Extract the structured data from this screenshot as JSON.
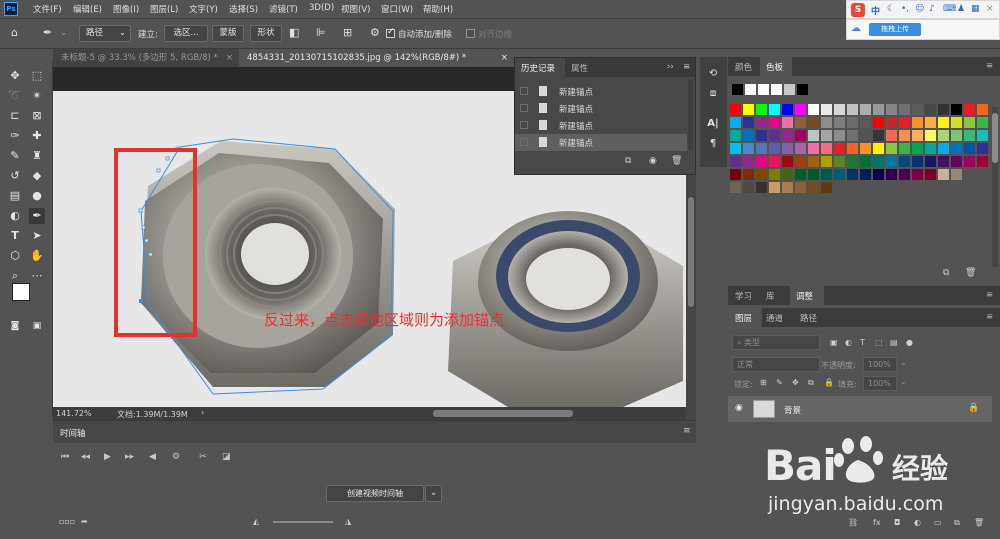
{
  "app": {
    "logo_text": "Ps"
  },
  "menu": [
    "文件(F)",
    "编辑(E)",
    "图像(I)",
    "图层(L)",
    "文字(Y)",
    "选择(S)",
    "滤镜(T)",
    "3D(D)",
    "视图(V)",
    "窗口(W)",
    "帮助(H)"
  ],
  "ime": {
    "logo": "S",
    "lang": "中"
  },
  "cloud": {
    "button": "拖拽上传"
  },
  "options": {
    "mode": "路径",
    "build_label": "建立:",
    "selection_btn": "选区...",
    "mask_btn": "蒙版",
    "shape_btn": "形状",
    "auto_add_delete": "自动添加/删除",
    "align_edges": "对齐边缘"
  },
  "tabs": [
    {
      "label": "未标题-5 @ 33.3% (多边形 5, RGB/8) *",
      "active": false
    },
    {
      "label": "4854331_20130715102835.jpg @ 142%(RGB/8#) *",
      "active": true
    }
  ],
  "canvas": {
    "annotation": "反过来，点击其他区域则为添加锚点"
  },
  "status": {
    "zoom": "141.72%",
    "doc": "文档:1.39M/1.39M"
  },
  "history": {
    "tab_history": "历史记录",
    "tab_properties": "属性",
    "rows": [
      "新建锚点",
      "新建锚点",
      "新建锚点",
      "新建锚点"
    ]
  },
  "timeline": {
    "title": "时间轴",
    "create_btn": "创建视频时间轴"
  },
  "right": {
    "color_tab": "颜色",
    "swatches_tab": "色板",
    "learn_tab": "学习",
    "library_tab": "库",
    "adjust_tab": "调整",
    "layers_tab": "图层",
    "channels_tab": "通道",
    "paths_tab": "路径",
    "kind_filter": "类型",
    "blend_mode": "正常",
    "opacity_label": "不透明度:",
    "opacity_value": "100%",
    "lock_label": "锁定:",
    "fill_label": "填充:",
    "fill_value": "100%",
    "layer_name": "背景"
  },
  "watermark": {
    "brand_left": "Bai",
    "brand_right": "经验",
    "url": "jingyan.baidu.com"
  },
  "colors": {
    "annotation": "#e8312f",
    "selection_box": "#e3322b",
    "path": "#3b8ee8"
  }
}
